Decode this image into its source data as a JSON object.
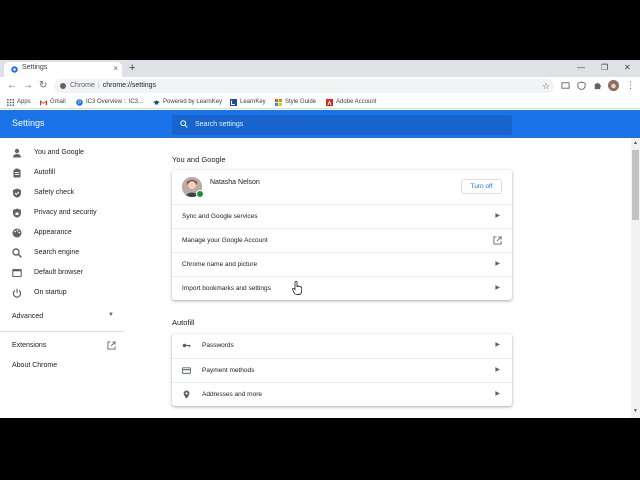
{
  "browser": {
    "tab_title": "Settings",
    "new_tab": "+",
    "tab_close": "×",
    "omnibox": {
      "site": "Chrome",
      "url": "chrome://settings"
    }
  },
  "bookmarks": [
    {
      "label": "Apps",
      "icon": "apps-grid-icon",
      "color": "#5f6368"
    },
    {
      "label": "Gmail",
      "icon": "gmail-icon",
      "color": "#d93025"
    },
    {
      "label": "IC3 Overview :: IC3...",
      "icon": "ic3-icon",
      "color": "#1a73e8"
    },
    {
      "label": "Powered by LearnKey",
      "icon": "learnkey-cap-icon",
      "color": "#1a4f8b"
    },
    {
      "label": "LearnKey",
      "icon": "learnkey-icon",
      "color": "#1a4f8b"
    },
    {
      "label": "Style Guide",
      "icon": "windows-logo-icon",
      "color": "#f25022"
    },
    {
      "label": "Adobe Account",
      "icon": "adobe-icon",
      "color": "#e1251b"
    }
  ],
  "header": {
    "title": "Settings",
    "search_placeholder": "Search settings"
  },
  "sidebar": {
    "items": [
      {
        "label": "You and Google",
        "icon": "person-icon"
      },
      {
        "label": "Autofill",
        "icon": "clipboard-icon"
      },
      {
        "label": "Safety check",
        "icon": "shield-check-icon"
      },
      {
        "label": "Privacy and security",
        "icon": "shield-lock-icon"
      },
      {
        "label": "Appearance",
        "icon": "palette-icon"
      },
      {
        "label": "Search engine",
        "icon": "search-icon"
      },
      {
        "label": "Default browser",
        "icon": "browser-window-icon"
      },
      {
        "label": "On startup",
        "icon": "power-icon"
      }
    ],
    "advanced": "Advanced",
    "extensions": "Extensions",
    "about": "About Chrome"
  },
  "main": {
    "you_and_google": {
      "title": "You and Google",
      "user_name": "Natasha Nelson",
      "turn_off": "Turn off",
      "rows": [
        {
          "label": "Sync and Google services"
        },
        {
          "label": "Manage your Google Account"
        },
        {
          "label": "Chrome name and picture"
        },
        {
          "label": "Import bookmarks and settings"
        }
      ]
    },
    "autofill": {
      "title": "Autofill",
      "rows": [
        {
          "label": "Passwords",
          "icon": "key-icon"
        },
        {
          "label": "Payment methods",
          "icon": "credit-card-icon"
        },
        {
          "label": "Addresses and more",
          "icon": "location-pin-icon"
        }
      ]
    }
  },
  "colors": {
    "accent": "#1a73e8",
    "search_bg": "#1765cc",
    "text": "#202124",
    "icon": "#5f6368"
  }
}
